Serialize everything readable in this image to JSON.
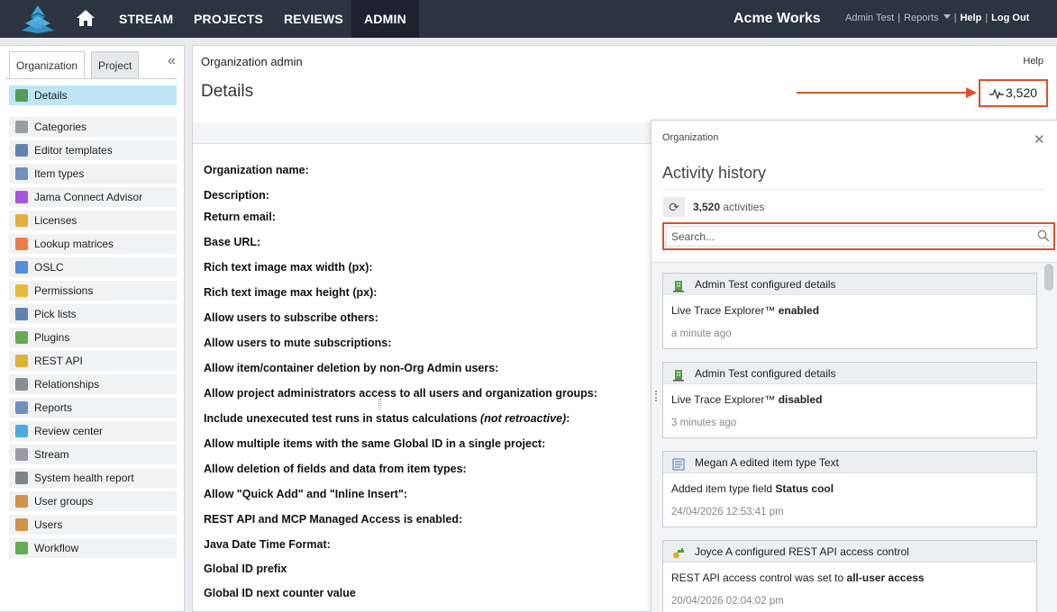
{
  "nav": {
    "items": [
      "STREAM",
      "PROJECTS",
      "REVIEWS",
      "ADMIN"
    ],
    "active": "ADMIN",
    "brand": "Acme Works",
    "user": "Admin Test",
    "reports": "Reports",
    "help": "Help",
    "logout": "Log Out"
  },
  "sidebar": {
    "tabs": [
      "Organization",
      "Project"
    ],
    "active_tab": "Organization",
    "items": [
      {
        "label": "Details",
        "icon": "building-icon",
        "color": "#3d8f3d"
      },
      {
        "label": "Categories",
        "icon": "tag-icon",
        "color": "#8a8f96"
      },
      {
        "label": "Editor templates",
        "icon": "template-icon",
        "color": "#4a6fa5"
      },
      {
        "label": "Item types",
        "icon": "item-types-icon",
        "color": "#5b7fb1"
      },
      {
        "label": "Jama Connect Advisor",
        "icon": "advisor-icon",
        "color": "#9b3bd6"
      },
      {
        "label": "Licenses",
        "icon": "key-icon",
        "color": "#e2a21c"
      },
      {
        "label": "Lookup matrices",
        "icon": "matrix-icon",
        "color": "#e46b2a"
      },
      {
        "label": "OSLC",
        "icon": "oslc-icon",
        "color": "#3a7bd5"
      },
      {
        "label": "Permissions",
        "icon": "shield-icon",
        "color": "#e3b21a"
      },
      {
        "label": "Pick lists",
        "icon": "list-icon",
        "color": "#4a6fa5"
      },
      {
        "label": "Plugins",
        "icon": "puzzle-icon",
        "color": "#4d9e3a"
      },
      {
        "label": "REST API",
        "icon": "api-key-icon",
        "color": "#d8a91a"
      },
      {
        "label": "Relationships",
        "icon": "link-icon",
        "color": "#777c83"
      },
      {
        "label": "Reports",
        "icon": "report-icon",
        "color": "#5b7fb1"
      },
      {
        "label": "Review center",
        "icon": "review-icon",
        "color": "#2f9ed8"
      },
      {
        "label": "Stream",
        "icon": "stream-icon",
        "color": "#888d94"
      },
      {
        "label": "System health report",
        "icon": "health-report-icon",
        "color": "#6b7078"
      },
      {
        "label": "User groups",
        "icon": "user-group-icon",
        "color": "#c9832e"
      },
      {
        "label": "Users",
        "icon": "user-icon",
        "color": "#c9832e"
      },
      {
        "label": "Workflow",
        "icon": "workflow-icon",
        "color": "#4d9e3a"
      }
    ]
  },
  "main": {
    "breadcrumb": "Organization admin",
    "help": "Help",
    "title": "Details",
    "activity_count": "3,520",
    "fields": [
      "Organization name:",
      "Description:",
      "Return email:",
      "Base URL:",
      "Rich text image max width (px):",
      "Rich text image max height (px):",
      "Allow users to subscribe others:",
      "Allow users to mute subscriptions:",
      "Allow item/container deletion by non-Org Admin users:",
      "Allow project administrators access to all users and organization groups:",
      "Include unexecuted test runs in status calculations",
      "Allow multiple items with the same Global ID in a single project:",
      "Allow deletion of fields and data from item types:",
      "Allow \"Quick Add\" and \"Inline Insert\":",
      "REST API and MCP Managed Access is enabled:",
      "Java Date Time Format:",
      "Global ID prefix",
      "Global ID next counter value"
    ],
    "field_note": "(not retroactive)",
    "field_note_suffix": ":"
  },
  "panel": {
    "context": "Organization",
    "title": "Activity history",
    "count": "3,520",
    "count_suffix": " activities",
    "search_placeholder": "Search...",
    "activities": [
      {
        "header": "Admin Test configured details",
        "icon": "building-icon",
        "body_prefix": "Live Trace Explorer™ ",
        "body_bold": "enabled",
        "time": "a minute ago"
      },
      {
        "header": "Admin Test configured details",
        "icon": "building-icon",
        "body_prefix": "Live Trace Explorer™ ",
        "body_bold": "disabled",
        "time": "3 minutes ago"
      },
      {
        "header": "Megan A edited item type Text",
        "icon": "item-types-icon",
        "body_prefix": "Added item type field ",
        "body_bold": "Status cool",
        "time": "24/04/2026 12:53:41 pm"
      },
      {
        "header": "Joyce A configured REST API access control",
        "icon": "api-key-icon",
        "body_prefix": "REST API access control was set to ",
        "body_bold": "all-user access",
        "time": "20/04/2026 02:04:02 pm"
      }
    ]
  }
}
